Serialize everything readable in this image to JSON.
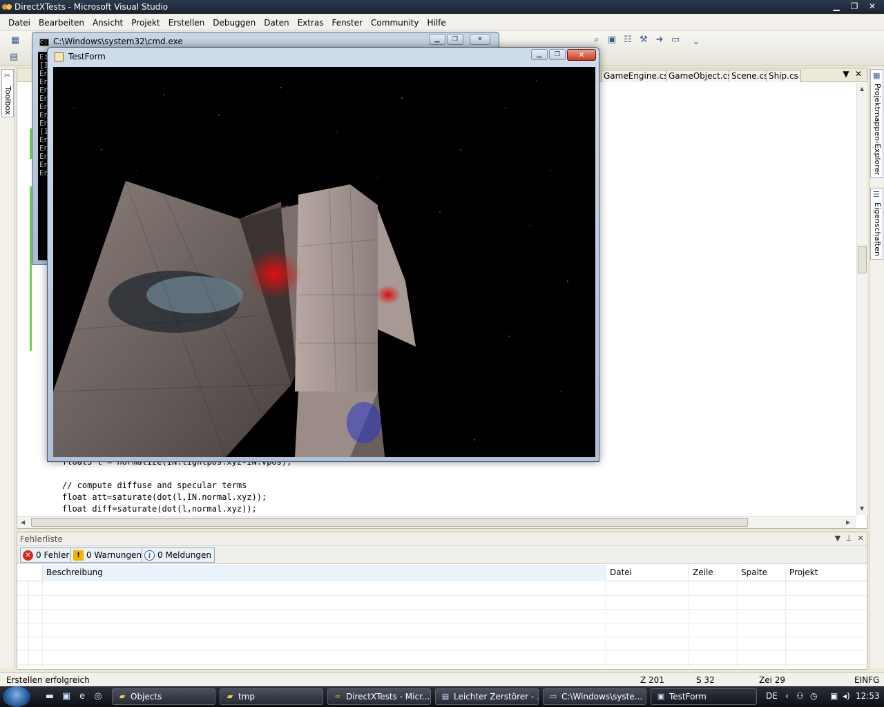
{
  "vs_window": {
    "title": "DirectXTests - Microsoft Visual Studio",
    "controls": {
      "minimize": "▁",
      "maximize": "❐",
      "close": "✕"
    }
  },
  "menu": [
    "Datei",
    "Bearbeiten",
    "Ansicht",
    "Projekt",
    "Erstellen",
    "Debuggen",
    "Daten",
    "Extras",
    "Fenster",
    "Community",
    "Hilfe"
  ],
  "side_panels": {
    "toolbox": "Toolbox",
    "solution_explorer": "Projektmappen-Explorer",
    "properties": "Eigenschaften"
  },
  "doc_tabs": [
    "GameEngine.cs",
    "GameObject.cs",
    "Scene.cs",
    "Ship.cs"
  ],
  "doc_tab_controls": {
    "dropdown": "▼",
    "close": "✕"
  },
  "code": {
    "partial_line": "float3 l = normalize(IN.lightpos.xyz-IN.vpos);",
    "lines": [
      "// compute diffuse and specular terms",
      "float att=saturate(dot(l,IN.normal.xyz));",
      "float diff=saturate(dot(l,normal.xyz));"
    ]
  },
  "error_list": {
    "title": "Fehlerliste",
    "filters": [
      {
        "label": "0 Fehler",
        "icon": "error-icon",
        "color": "#d8261c"
      },
      {
        "label": "0 Warnungen",
        "icon": "warning-icon",
        "color": "#f0b400"
      },
      {
        "label": "0 Meldungen",
        "icon": "info-icon",
        "color": "#2a5a9a"
      }
    ],
    "columns": [
      "Beschreibung",
      "Datei",
      "Zeile",
      "Spalte",
      "Projekt"
    ]
  },
  "status": {
    "message": "Erstellen erfolgreich",
    "line": "Z 201",
    "col": "S 32",
    "char": "Zei 29",
    "mode": "EINFG"
  },
  "cmd_window": {
    "title": "C:\\Windows\\system32\\cmd.exe",
    "lines": [
      "Ei",
      "[I",
      "En",
      "En",
      "En",
      "En",
      "En",
      "En",
      "En",
      "[I",
      "En",
      "En",
      "En",
      "En",
      "En"
    ]
  },
  "testform": {
    "title": "TestForm"
  },
  "taskbar": {
    "tasks": [
      {
        "label": "Objects",
        "icon": "folder-icon"
      },
      {
        "label": "tmp",
        "icon": "folder-icon"
      },
      {
        "label": "DirectXTests - Micr...",
        "icon": "visual-studio-icon"
      },
      {
        "label": "Leichter Zerstörer - ...",
        "icon": "document-icon"
      },
      {
        "label": "C:\\Windows\\syste...",
        "icon": "cmd-icon"
      },
      {
        "label": "TestForm",
        "icon": "window-icon"
      }
    ],
    "lang": "DE",
    "clock": "12:53"
  },
  "colors": {
    "accent": "#2c3a4e",
    "change_bar": "#6ad24a",
    "close_red": "#c43a22"
  }
}
